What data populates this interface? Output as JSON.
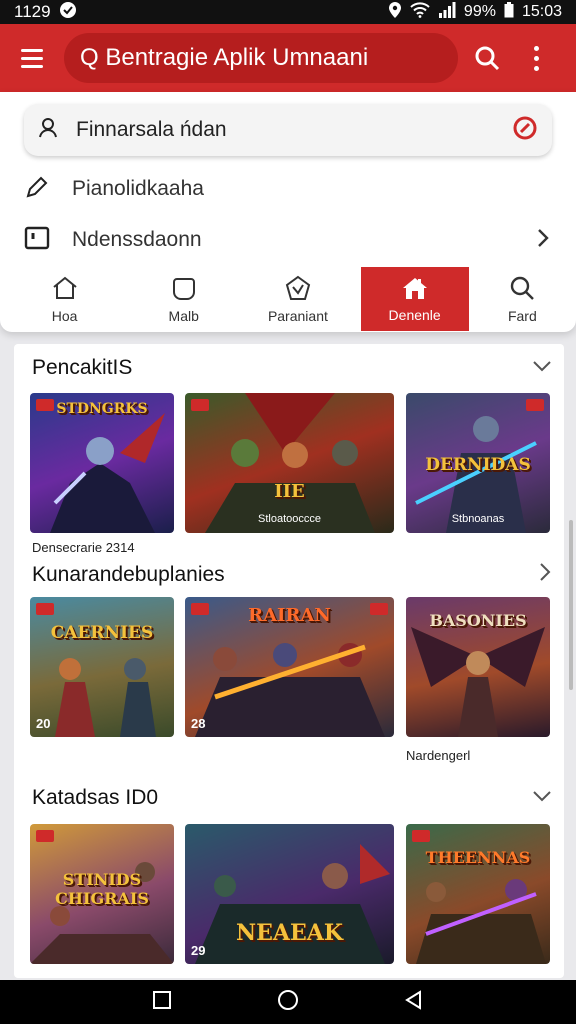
{
  "status_bar": {
    "time_left": "1129",
    "battery": "99%",
    "time_right": "15:03"
  },
  "app_bar": {
    "search_text": "Q Bentragie Aplik Umnaani"
  },
  "suggestions": {
    "input_text": "Finnarsala ńdan",
    "item_1": "Pianolidkaaha",
    "item_2": "Ndenssdaonn"
  },
  "tabs": [
    {
      "label": "Hoa",
      "icon": "home-icon"
    },
    {
      "label": "Malb",
      "icon": "shield-icon"
    },
    {
      "label": "Paraniant",
      "icon": "badge-icon"
    },
    {
      "label": "Denenle",
      "icon": "house-icon"
    },
    {
      "label": "Fard",
      "icon": "search-icon"
    }
  ],
  "sections": [
    {
      "title": "PencakitIS",
      "cards": [
        {
          "title": "STDNGRKS",
          "subtitle": "",
          "number": ""
        },
        {
          "title": "IIE",
          "subtitle": "Stloatooccce",
          "number": ""
        },
        {
          "title": "DERNIDAS",
          "subtitle": "Stbnoanas",
          "number": ""
        }
      ],
      "caption": "Densecrarie 2314"
    },
    {
      "title": "Kunarandebuplanies",
      "cards": [
        {
          "title": "CAERNIES",
          "subtitle": "",
          "number": "20"
        },
        {
          "title": "RAIRAN",
          "subtitle": "",
          "number": "28"
        },
        {
          "title": "BASONIES",
          "subtitle": "",
          "number": ""
        }
      ],
      "caption": "Nardengerl"
    },
    {
      "title": "Katadsas ID0",
      "cards": [
        {
          "title": "STINIDS CHIGRAIS",
          "subtitle": "",
          "number": ""
        },
        {
          "title": "NEAEAK",
          "subtitle": "",
          "number": "29"
        },
        {
          "title": "THEENNAS",
          "subtitle": "",
          "number": ""
        }
      ],
      "caption": ""
    }
  ],
  "colors": {
    "accent": "#cf2a2a",
    "accent_dark": "#b51e1e",
    "navbar": "#000000"
  }
}
